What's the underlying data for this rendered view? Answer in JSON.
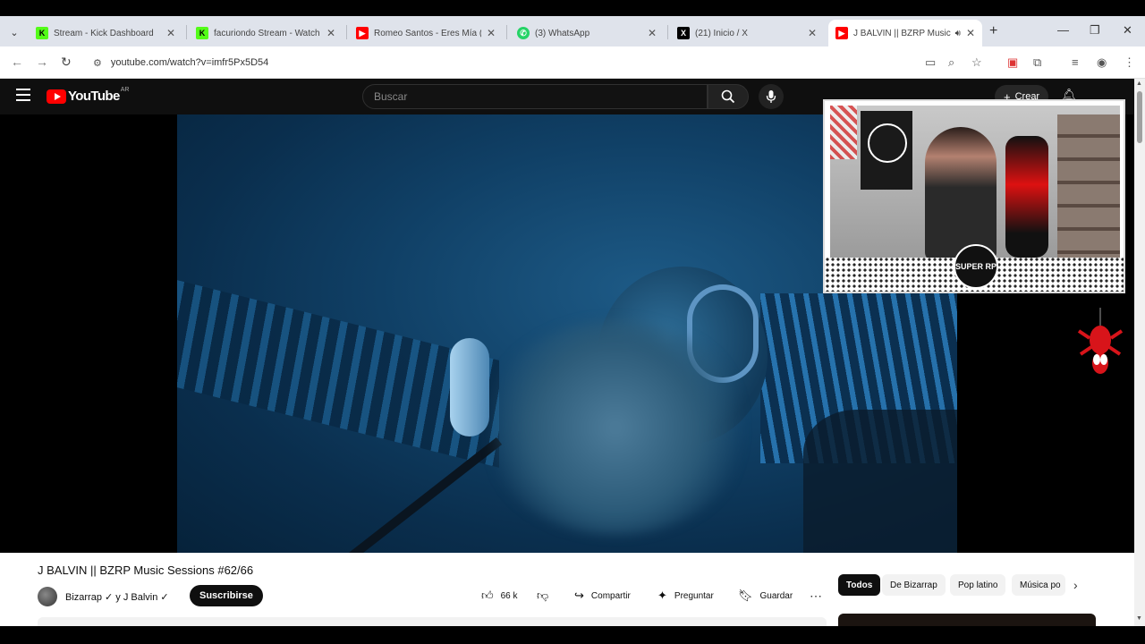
{
  "browser": {
    "tabs": [
      {
        "title": "Stream - Kick Dashboard",
        "favicon": "kick-icon",
        "color": "#53fc18"
      },
      {
        "title": "facuriondo Stream - Watch L",
        "favicon": "kick-icon",
        "color": "#53fc18"
      },
      {
        "title": "Romeo Santos - Eres Mía (La",
        "favicon": "youtube-icon",
        "color": "#ff0000"
      },
      {
        "title": "(3) WhatsApp",
        "favicon": "whatsapp-icon",
        "color": "#25d366"
      },
      {
        "title": "(21) Inicio / X",
        "favicon": "x-icon",
        "color": "#000000"
      },
      {
        "title": "J BALVIN || BZRP Music S",
        "favicon": "youtube-icon",
        "color": "#ff0000",
        "active": true,
        "playing_audio": true
      }
    ],
    "url": "youtube.com/watch?v=imfr5Px5D54"
  },
  "youtube": {
    "logo_text": "YouTube",
    "country_code": "AR",
    "search_placeholder": "Buscar",
    "create_label": "Crear",
    "video": {
      "title": "J BALVIN || BZRP Music Sessions #62/66",
      "channel": "Bizarrap ✓ y J Balvin ✓",
      "subscribe_label": "Suscribirse",
      "likes": "66 k",
      "share_label": "Compartir",
      "ask_label": "Preguntar",
      "save_label": "Guardar"
    },
    "chips": [
      {
        "label": "Todos",
        "selected": true
      },
      {
        "label": "De Bizarrap",
        "selected": false
      },
      {
        "label": "Pop latino",
        "selected": false
      },
      {
        "label": "Música po",
        "selected": false
      }
    ]
  },
  "overlay": {
    "badge_text": "SUPER RP"
  },
  "colors": {
    "youtube_red": "#ff0000",
    "kick_green": "#53fc18",
    "whatsapp_green": "#25d366",
    "video_blue": "#104066"
  }
}
